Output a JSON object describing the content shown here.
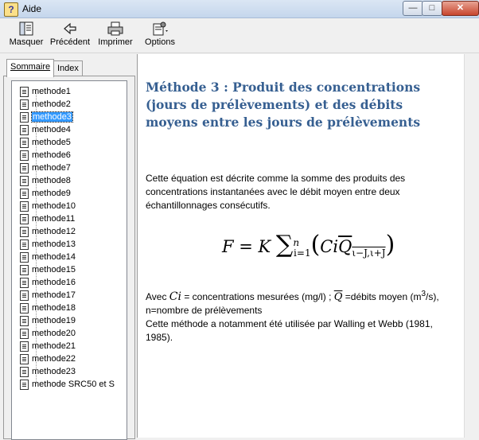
{
  "window": {
    "title": "Aide",
    "min_glyph": "—",
    "max_glyph": "□",
    "close_glyph": "✕"
  },
  "toolbar": {
    "hide_label": "Masquer",
    "back_label": "Précédent",
    "print_label": "Imprimer",
    "options_label": "Options"
  },
  "nav": {
    "tabs": [
      {
        "label": "Sommaire"
      },
      {
        "label": "Index"
      }
    ],
    "items": [
      {
        "label": "methode1"
      },
      {
        "label": "methode2"
      },
      {
        "label": "methode3",
        "selected": true
      },
      {
        "label": "methode4"
      },
      {
        "label": "methode5"
      },
      {
        "label": "methode6"
      },
      {
        "label": "methode7"
      },
      {
        "label": "methode8"
      },
      {
        "label": "methode9"
      },
      {
        "label": "methode10"
      },
      {
        "label": "methode11"
      },
      {
        "label": "methode12"
      },
      {
        "label": "methode13"
      },
      {
        "label": "methode14"
      },
      {
        "label": "methode15"
      },
      {
        "label": "methode16"
      },
      {
        "label": "methode17"
      },
      {
        "label": "methode18"
      },
      {
        "label": "methode19"
      },
      {
        "label": "methode20"
      },
      {
        "label": "methode21"
      },
      {
        "label": "methode22"
      },
      {
        "label": "methode23"
      },
      {
        "label": "methode SRC50 et S"
      }
    ]
  },
  "content": {
    "heading": "Méthode 3 : Produit des concentrations (jours de prélèvements) et des débits moyens entre les jours de prélèvements",
    "para1": "Cette équation est décrite comme la somme des produits des concentrations instantanées avec le débit moyen entre deux échantillonnages consécutifs.",
    "formula": {
      "lhs": "F = K ",
      "sum": "∑",
      "sub": "i=1",
      "sup": "n",
      "open": "(",
      "ci": "Ci",
      "q": "Q",
      "qsub": "ι−J,ι+J",
      "close": ")"
    },
    "para2": {
      "avec": "Avec ",
      "ci": "Ci",
      "ci_def": " = concentrations mesurées (mg/l) ; ",
      "qbar": "Q",
      "q_def": " =débits moyen (m",
      "exp": "3",
      "q_def_end": "/s), n=nombre de prélèvements",
      "line2": "Cette méthode a notamment été utilisée par Walling et Webb (1981, 1985)."
    }
  },
  "colors": {
    "heading": "#365f91",
    "selection": "#3399ff",
    "close_button": "#c7452d"
  },
  "icons": {
    "app": "help-book-icon",
    "hide": "hide-panel-icon",
    "back": "back-arrow-icon",
    "print": "printer-icon",
    "options": "options-icon",
    "topic": "document-page-icon"
  }
}
